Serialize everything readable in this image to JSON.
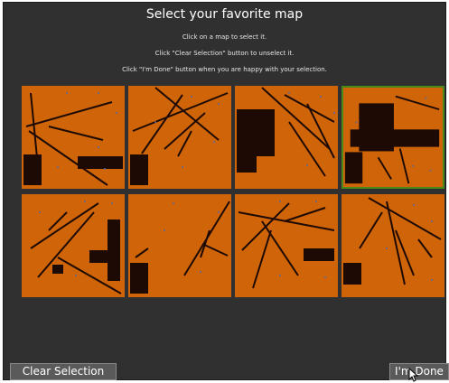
{
  "title": "Select your favorite map",
  "instructions": [
    "Click on a map to select it.",
    "Click \"Clear Selection\" button to unselect it.",
    "Click \"I'm Done\" button when you are happy with your selection."
  ],
  "maps": [
    {
      "selected": false
    },
    {
      "selected": false
    },
    {
      "selected": false
    },
    {
      "selected": true
    },
    {
      "selected": false
    },
    {
      "selected": false
    },
    {
      "selected": false
    },
    {
      "selected": false
    }
  ],
  "buttons": {
    "clear_label": "Clear Selection",
    "done_label": "I'm Done"
  },
  "colors": {
    "background": "#303030",
    "map_fill": "#cf6408",
    "wall": "#1e0a04",
    "selected_border": "#4a8a1a"
  }
}
